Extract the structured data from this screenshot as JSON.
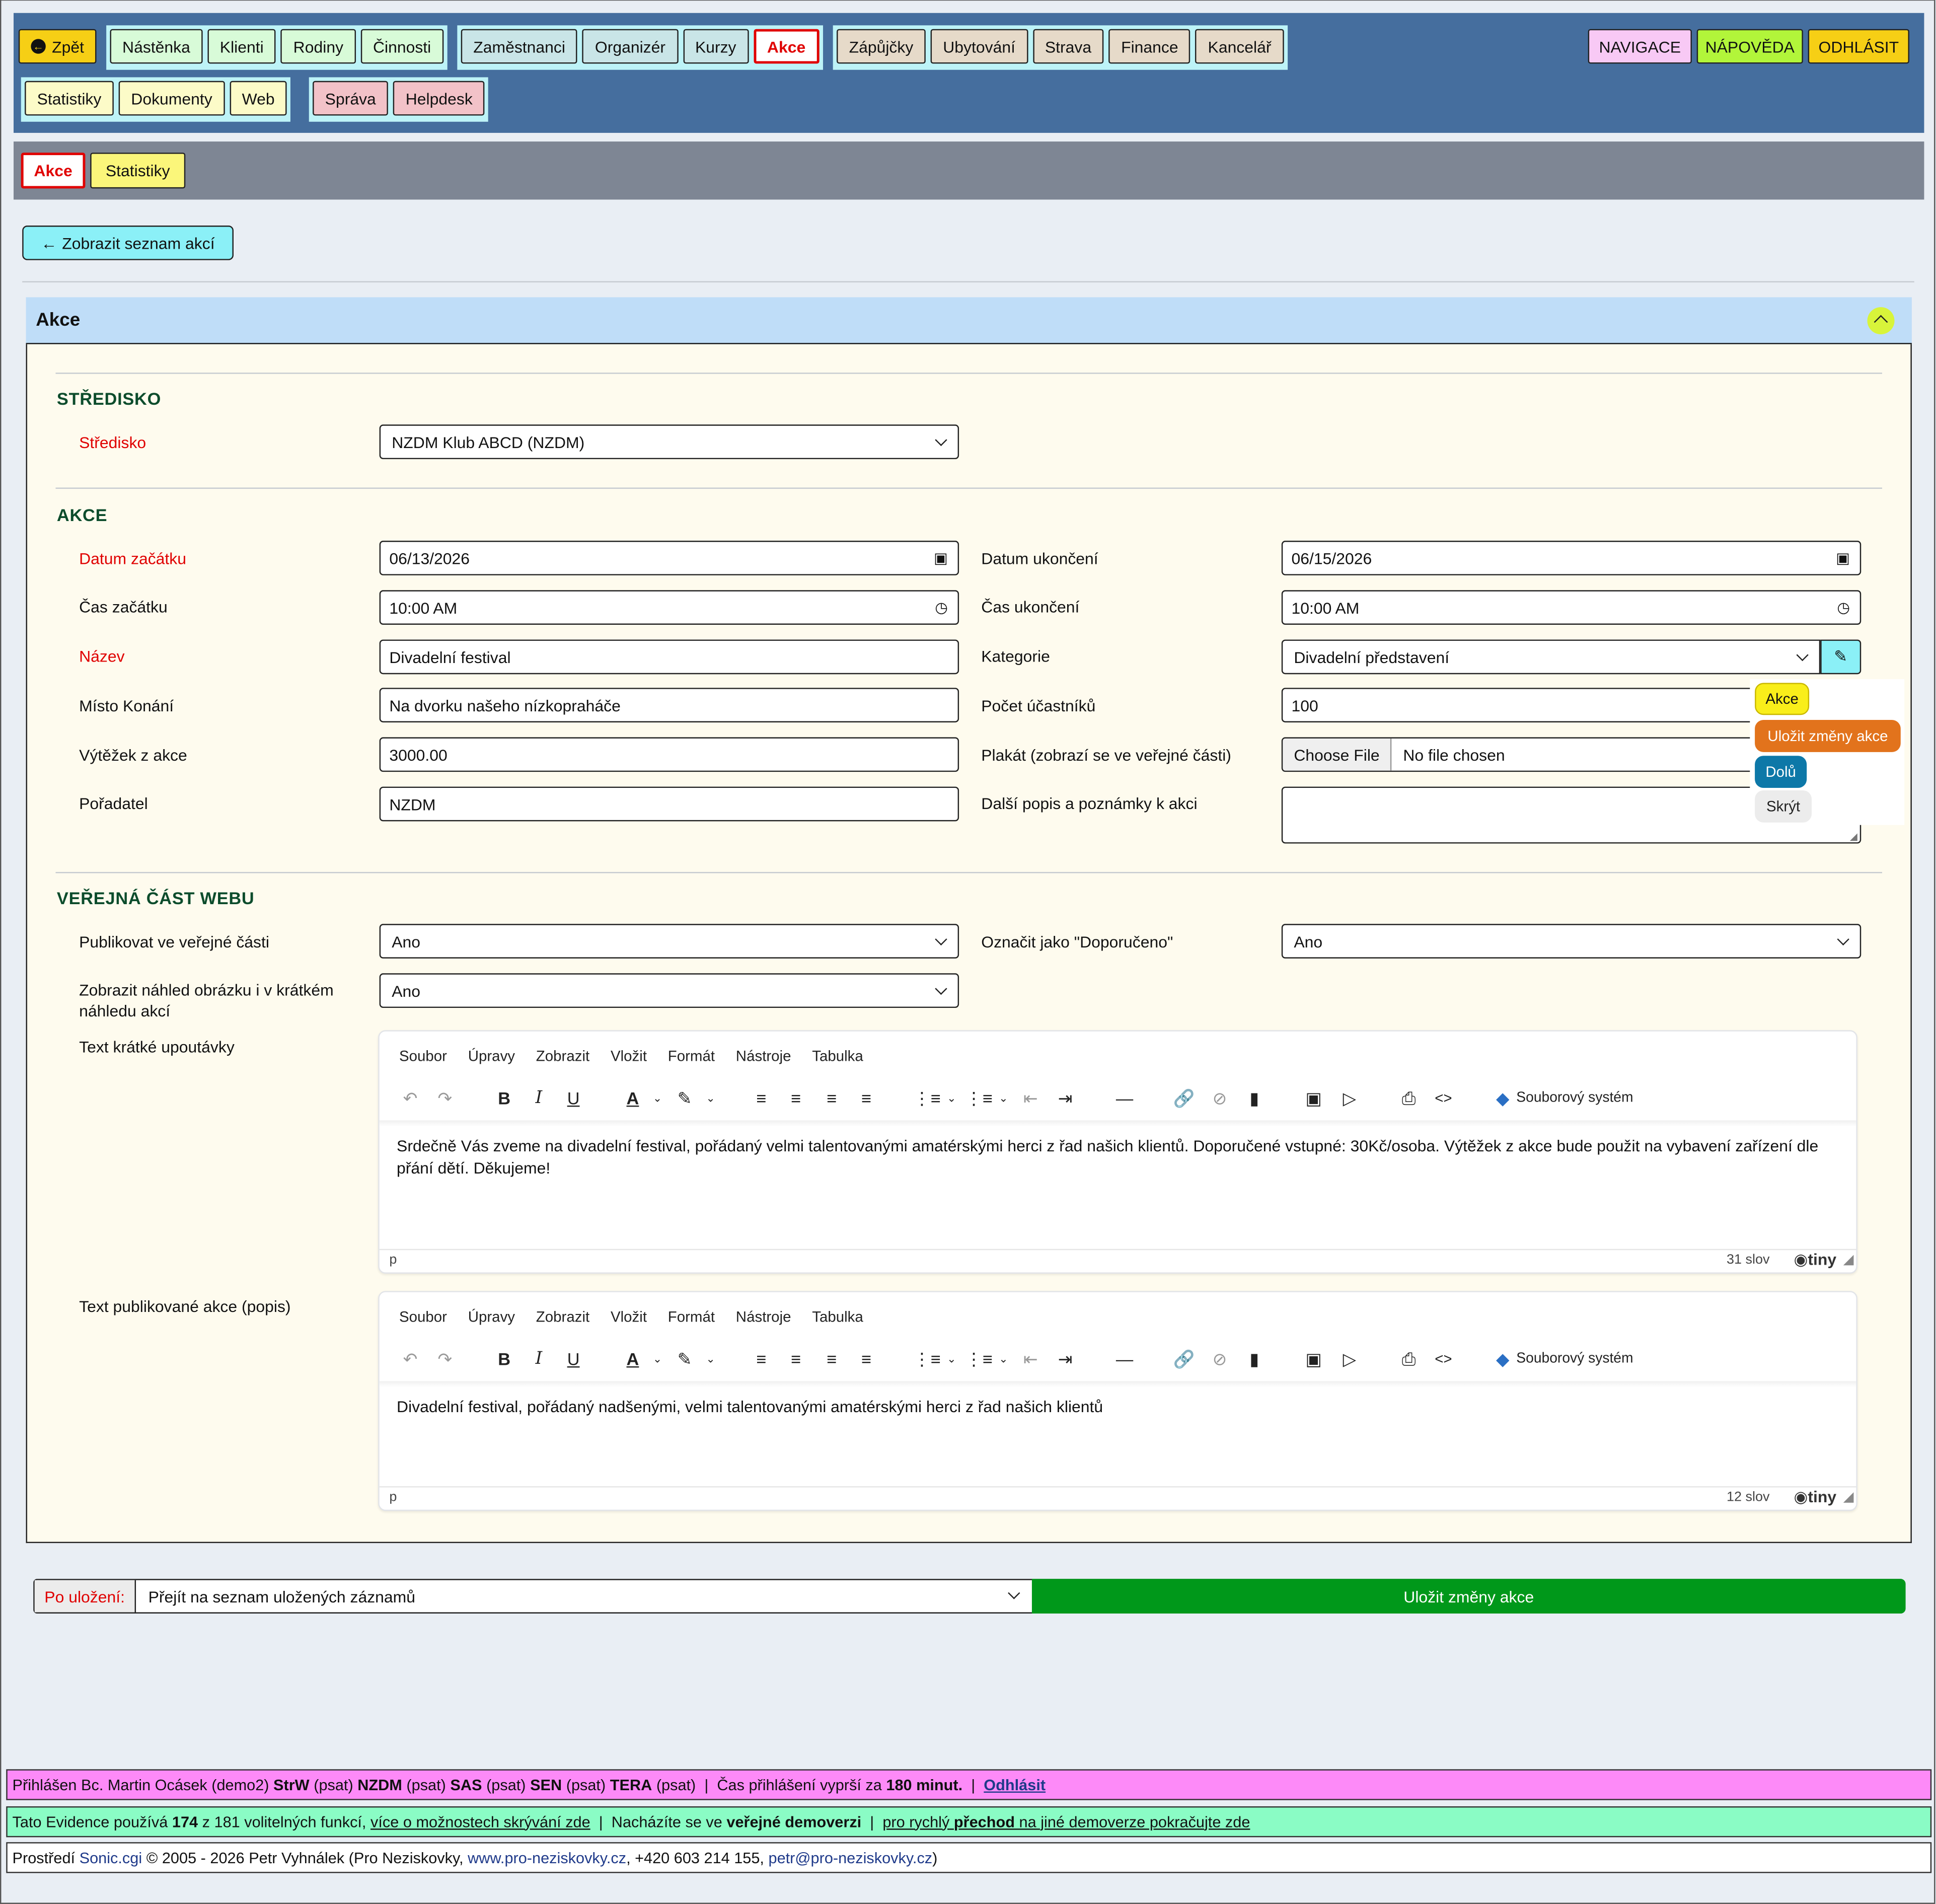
{
  "topnav": {
    "back": "Zpět",
    "group1": [
      "Nástěnka",
      "Klienti",
      "Rodiny",
      "Činnosti"
    ],
    "group2": [
      "Zaměstnanci",
      "Organizér",
      "Kurzy",
      "Akce"
    ],
    "group3": [
      "Zápůjčky",
      "Ubytování",
      "Strava",
      "Finance",
      "Kancelář"
    ],
    "group4": [
      "Statistiky",
      "Dokumenty",
      "Web"
    ],
    "group5": [
      "Správa",
      "Helpdesk"
    ],
    "navigace": "NAVIGACE",
    "napoveda": "NÁPOVĚDA",
    "odhlasit": "ODHLÁSIT"
  },
  "subnav": {
    "akce": "Akce",
    "statistiky": "Statistiky"
  },
  "back_list": "Zobrazit seznam akcí",
  "panel_title": "Akce",
  "sections": {
    "stredisko": "STŘEDISKO",
    "akce": "AKCE",
    "web": "VEŘEJNÁ ČÁST WEBU"
  },
  "form": {
    "stredisko_label": "Středisko",
    "stredisko_value": "NZDM Klub ABCD (NZDM)",
    "datum_zacatku_label": "Datum začátku",
    "datum_zacatku": "06/13/2026",
    "datum_ukonceni_label": "Datum ukončení",
    "datum_ukonceni": "06/15/2026",
    "cas_zacatku_label": "Čas začátku",
    "cas_zacatku": "10:00 AM",
    "cas_ukonceni_label": "Čas ukončení",
    "cas_ukonceni": "10:00 AM",
    "nazev_label": "Název",
    "nazev": "Divadelní festival",
    "kategorie_label": "Kategorie",
    "kategorie": "Divadelní představení",
    "misto_label": "Místo Konání",
    "misto": "Na dvorku našeho nízkopraháče",
    "pocet_label": "Počet účastníků",
    "pocet": "100",
    "vytezek_label": "Výtěžek z akce",
    "vytezek": "3000.00",
    "plakat_label": "Plakát (zobrazí se ve veřejné části)",
    "choose_file": "Choose File",
    "no_file": "No file chosen",
    "poradatel_label": "Pořadatel",
    "poradatel": "NZDM",
    "popis_label": "Další popis a poznámky k akci",
    "publikovat_label": "Publikovat ve veřejné části",
    "publikovat": "Ano",
    "doporuceno_label": "Označit jako \"Doporučeno\"",
    "doporuceno": "Ano",
    "nahled_label": "Zobrazit náhled obrázku i v krátkém náhledu akcí",
    "nahled": "Ano",
    "upoutavka_label": "Text krátké upoutávky",
    "publikovana_label": "Text publikované akce (popis)"
  },
  "editor_menu": [
    "Soubor",
    "Úpravy",
    "Zobrazit",
    "Vložit",
    "Formát",
    "Nástroje",
    "Tabulka"
  ],
  "editor_filesystem": "Souborový systém",
  "editor1": {
    "text": "Srdečně Vás zveme na divadelní festival, pořádaný velmi talentovanými amatérskými herci z řad našich klientů. Doporučené vstupné: 30Kč/osoba. Výtěžek z akce bude použit na vybavení zařízení dle přání dětí. Děkujeme!",
    "path": "p",
    "words": "31 slov",
    "brand": "tiny"
  },
  "editor2": {
    "text": "Divadelní festival, pořádaný nadšenými, velmi talentovanými amatérskými herci z řad našich klientů",
    "path": "p",
    "words": "12 slov",
    "brand": "tiny"
  },
  "side": {
    "akce": "Akce",
    "ulozit": "Uložit změny akce",
    "dolu": "Dolů",
    "skryt": "Skrýt"
  },
  "save": {
    "label": "Po uložení:",
    "option": "Přejít na seznam uložených záznamů",
    "button": "Uložit změny akce"
  },
  "footer": {
    "l1_a": "Přihlášen Bc. Martin Ocásek (demo2)",
    "l1_b": "StrW",
    "l1_c": "(psat)",
    "l1_d": "NZDM",
    "l1_e": "(psat)",
    "l1_f": "SAS",
    "l1_g": "(psat)",
    "l1_h": "SEN",
    "l1_i": "(psat)",
    "l1_j": "TERA",
    "l1_k": "(psat)  |  Čas přihlášení vyprší za",
    "l1_l": "180 minut.",
    "l1_m": "|",
    "l1_n": "Odhlásit",
    "l2_a": "Tato Evidence používá",
    "l2_b": "174",
    "l2_c": "z 181 volitelných funkcí,",
    "l2_d": "více o možnostech skrývání zde",
    "l2_e": "|  Nacházíte se ve",
    "l2_f": "veřejné demoverzi",
    "l2_g": "|",
    "l2_h": "pro rychlý",
    "l2_i": "přechod",
    "l2_j": "na jiné demoverze pokračujte zde",
    "l3_a": "Prostředí",
    "l3_b": "Sonic.cgi",
    "l3_c": "© 2005 - 2026 Petr Vyhnálek (Pro Neziskovky,",
    "l3_d": "www.pro-neziskovky.cz",
    ",": ",",
    "l3_e": ", +420 603 214 155,",
    "l3_f": "petr@pro-neziskovky.cz",
    "l3_g": ")"
  },
  "colors": {
    "accent_green": "#00981a",
    "nav_bg": "#456e9e",
    "active_red": "#e00000"
  }
}
